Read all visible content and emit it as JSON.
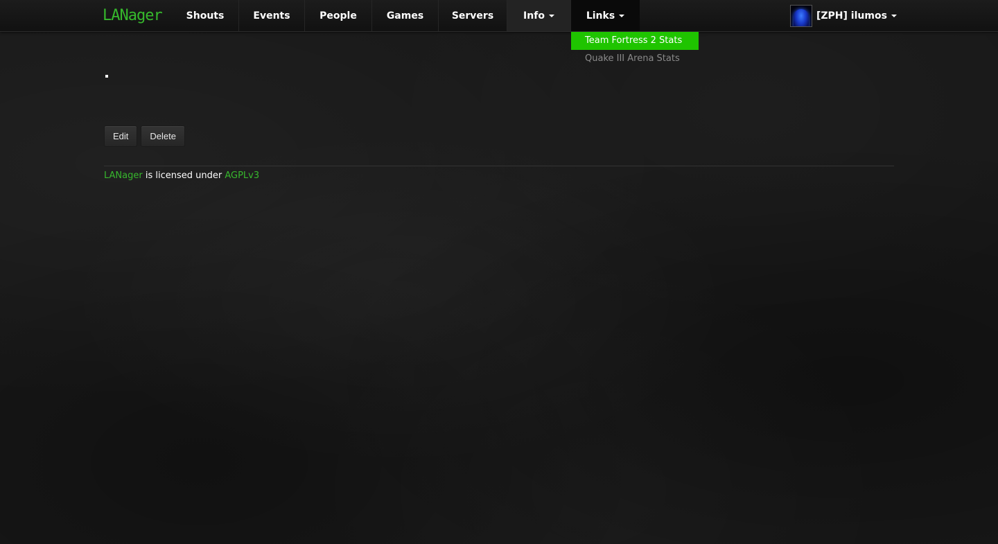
{
  "brand": {
    "name": "LANager",
    "color": "#36b82c"
  },
  "nav": {
    "items": [
      {
        "label": "Shouts"
      },
      {
        "label": "Events"
      },
      {
        "label": "People"
      },
      {
        "label": "Games"
      },
      {
        "label": "Servers"
      },
      {
        "label": "Info",
        "dropdown": true
      },
      {
        "label": "Links",
        "dropdown": true,
        "open": true
      }
    ]
  },
  "links_dropdown": {
    "items": [
      {
        "label": "Team Fortress 2 Stats",
        "highlighted": true
      },
      {
        "label": "Quake III Arena Stats",
        "highlighted": false
      }
    ],
    "highlight_color": "#1fc400"
  },
  "user": {
    "name": "[ZPH] ilumos",
    "avatar_icon": "blue-arch-avatar"
  },
  "actions": {
    "edit_label": "Edit",
    "delete_label": "Delete"
  },
  "footer": {
    "project_link": "LANager",
    "middle_text": " is licensed under ",
    "license_link": "AGPLv3",
    "link_color": "#37b82d"
  }
}
